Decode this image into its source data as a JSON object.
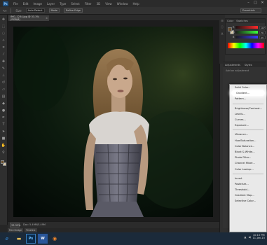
{
  "app": {
    "logo": "Ps",
    "menus": [
      "File",
      "Edit",
      "Image",
      "Layer",
      "Type",
      "Select",
      "Filter",
      "3D",
      "View",
      "Window",
      "Help"
    ],
    "window_controls": [
      "–",
      "□",
      "✕"
    ]
  },
  "options_bar": {
    "size_label": "Size",
    "size_value": "Auto Detect",
    "mode_btn": "Mode",
    "refine_btn": "Refine Edge",
    "workspace": "Essentials"
  },
  "document": {
    "tab_title": "IMG_1234.jpg @ 33.3% (RGB/8)",
    "close": "×",
    "zoom": "33.33%",
    "doc_info": "Doc: 5.49M/5.49M"
  },
  "mini_bridge": [
    "Mini Bridge",
    "Timeline"
  ],
  "panels": {
    "color_tabs": [
      "Color",
      "Swatches"
    ],
    "channels": [
      {
        "label": "R",
        "value": "107"
      },
      {
        "label": "G",
        "value": "79"
      },
      {
        "label": "B",
        "value": "43"
      }
    ],
    "adjustments_tabs": [
      "Adjustments",
      "Styles"
    ],
    "adjustments_sub": "Add an adjustment"
  },
  "dropdown": {
    "groups": [
      [
        "Solid Color...",
        "Gradient...",
        "Pattern..."
      ],
      [
        "Brightness/Contrast...",
        "Levels...",
        "Curves...",
        "Exposure..."
      ],
      [
        "Vibrance...",
        "Hue/Saturation...",
        "Color Balance...",
        "Black & White...",
        "Photo Filter...",
        "Channel Mixer...",
        "Color Lookup..."
      ],
      [
        "Invert",
        "Posterize...",
        "Threshold...",
        "Gradient Map...",
        "Selective Color..."
      ]
    ],
    "highlighted": "Gradient..."
  },
  "taskbar": {
    "apps": [
      "ie",
      "folder",
      "ps",
      "word",
      "firefox"
    ],
    "ps_label": "Ps",
    "word_label": "W",
    "time": "10:15 PM",
    "date": "11-Jan-15"
  },
  "colors": {
    "foreground": "#6b4f2b",
    "background": "#d8c9a8"
  }
}
